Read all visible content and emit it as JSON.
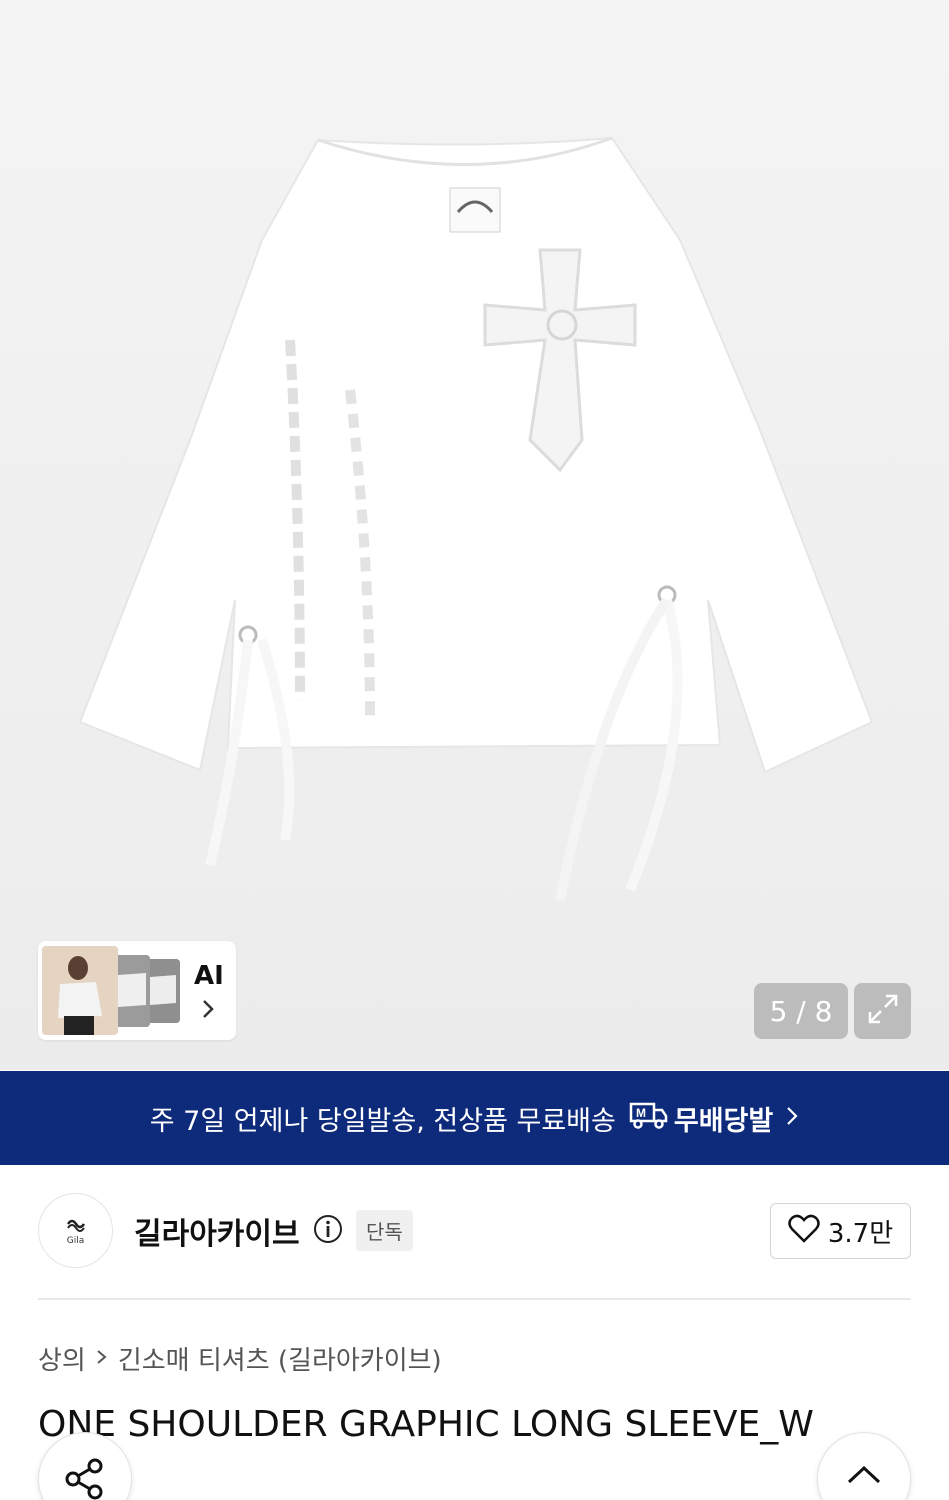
{
  "gallery": {
    "image_alt": "ONE SHOULDER GRAPHIC LONG SLEEVE white product photo",
    "ai_label": "AI",
    "page_indicator": "5 / 8",
    "icons": {
      "expand": "expand-icon",
      "ai_chevron": "chevron-right-icon"
    }
  },
  "banner": {
    "text": "주 7일 언제나 당일발송, 전상품 무료배송",
    "badge": "무배당발",
    "color": "#0e2a7b",
    "icons": {
      "truck": "delivery-truck-icon",
      "chevron": "chevron-right-icon"
    }
  },
  "brand": {
    "logo_text": "Gila",
    "name": "길라아카이브",
    "exclusive_badge": "단독",
    "likes": "3.7만",
    "icons": {
      "info": "info-icon",
      "heart": "heart-icon"
    }
  },
  "breadcrumb": {
    "level1": "상의",
    "level2": "긴소매 티셔츠 (길라아카이브)"
  },
  "product": {
    "title": "ONE SHOULDER GRAPHIC LONG SLEEVE_W"
  },
  "fab": {
    "share_icon": "share-icon",
    "top_icon": "chevron-up-icon"
  }
}
